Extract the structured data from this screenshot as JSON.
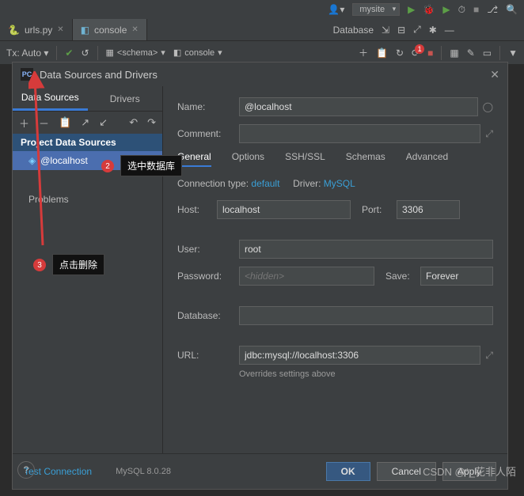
{
  "top": {
    "person_icon": "person-icon",
    "site": "mysite",
    "play": "▶",
    "bug": "⬢",
    "stop": "■",
    "next": "▷",
    "back": "◁",
    "search": "🔍"
  },
  "tabs": {
    "urls": "urls.py",
    "console": "console"
  },
  "database_label": "Database",
  "db_toolbar": {
    "tx_auto": "Tx: Auto",
    "schema": "<schema>",
    "console": "console"
  },
  "dialog": {
    "title": "Data Sources and Drivers",
    "side_tabs": {
      "data_sources": "Data Sources",
      "drivers": "Drivers"
    },
    "group": "Project Data Sources",
    "item": "@localhost",
    "problems": "Problems"
  },
  "form": {
    "name_label": "Name:",
    "name": "@localhost",
    "comment_label": "Comment:",
    "comment": "",
    "tabs": {
      "general": "General",
      "options": "Options",
      "ssh": "SSH/SSL",
      "schemas": "Schemas",
      "advanced": "Advanced"
    },
    "conn_type_label": "Connection type:",
    "conn_type": "default",
    "driver_label": "Driver:",
    "driver": "MySQL",
    "host_label": "Host:",
    "host": "localhost",
    "port_label": "Port:",
    "port": "3306",
    "user_label": "User:",
    "user": "root",
    "password_label": "Password:",
    "password_placeholder": "<hidden>",
    "save_label": "Save:",
    "save": "Forever",
    "database_label": "Database:",
    "database": "",
    "url_label": "URL:",
    "url": "jdbc:mysql://localhost:3306",
    "override": "Overrides settings above"
  },
  "footer": {
    "test": "Test Connection",
    "version": "MySQL 8.0.28",
    "ok": "OK",
    "cancel": "Cancel",
    "apply": "Apply"
  },
  "callouts": {
    "c2": "选中数据库",
    "c3": "点击删除"
  },
  "watermark": "CSDN @*_花非人陌"
}
